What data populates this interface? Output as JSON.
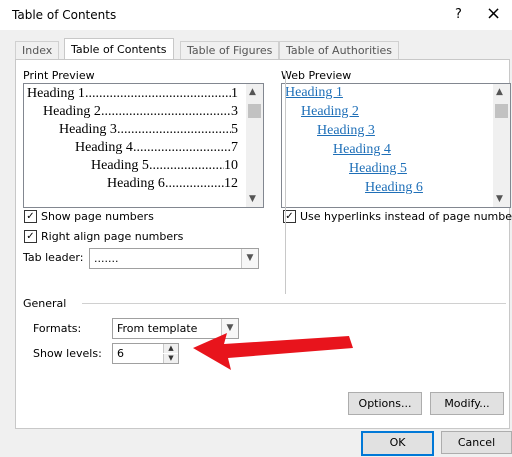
{
  "window": {
    "title": "Table of Contents",
    "help_glyph": "?",
    "close_glyph": "×"
  },
  "tabs": [
    {
      "label": "Index"
    },
    {
      "label": "Table of Contents"
    },
    {
      "label": "Table of Figures"
    },
    {
      "label": "Table of Authorities"
    }
  ],
  "print_preview": {
    "label": "Print Preview",
    "entries": [
      {
        "text": "Heading 1",
        "page": "1"
      },
      {
        "text": "Heading 2",
        "page": "3"
      },
      {
        "text": "Heading 3",
        "page": "5"
      },
      {
        "text": "Heading 4",
        "page": "7"
      },
      {
        "text": "Heading 5",
        "page": "10"
      },
      {
        "text": "Heading 6",
        "page": "12"
      }
    ]
  },
  "web_preview": {
    "label": "Web Preview",
    "entries": [
      "Heading 1",
      "Heading 2",
      "Heading 3",
      "Heading 4",
      "Heading 5",
      "Heading 6"
    ]
  },
  "options": {
    "show_page_numbers": {
      "label": "Show page numbers",
      "checked": true
    },
    "right_align": {
      "label": "Right align page numbers",
      "checked": true
    },
    "use_hyperlinks": {
      "label": "Use hyperlinks instead of page numbers",
      "checked": true
    },
    "tab_leader": {
      "label": "Tab leader:",
      "value": "......."
    }
  },
  "general": {
    "label": "General",
    "formats": {
      "label": "Formats:",
      "value": "From template"
    },
    "show_levels": {
      "label": "Show levels:",
      "value": "6"
    }
  },
  "buttons": {
    "options": "Options...",
    "modify": "Modify...",
    "ok": "OK",
    "cancel": "Cancel"
  },
  "annotation": {
    "arrow_color": "#e8141c"
  }
}
